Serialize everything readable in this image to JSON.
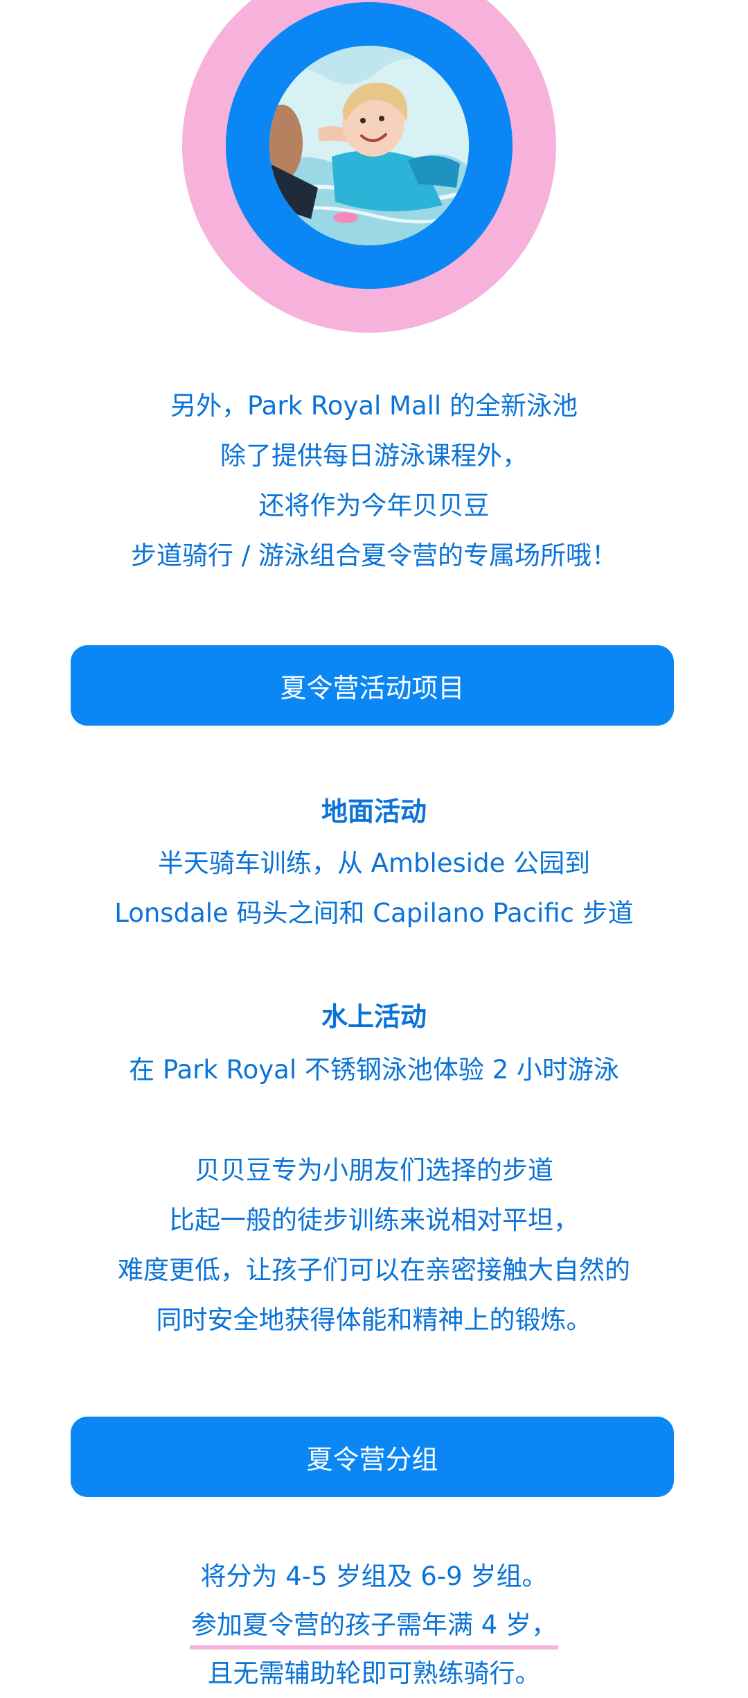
{
  "intro_lines": [
    "另外，Park Royal Mall 的全新泳池",
    "除了提供每日游泳课程外，",
    "还将作为今年贝贝豆",
    "步道骑行 / 游泳组合夏令营的专属场所哦！"
  ],
  "activities_button": "夏令营活动项目",
  "ground": {
    "title": "地面活动",
    "lines": [
      "半天骑车训练，从 Ambleside 公园到",
      "Lonsdale 码头之间和 Capilano Pacific 步道"
    ]
  },
  "water": {
    "title": "水上活动",
    "lines": [
      "在 Park Royal 不锈钢泳池体验 2 小时游泳"
    ]
  },
  "description_lines": [
    "贝贝豆专为小朋友们选择的步道",
    "比起一般的徒步训练来说相对平坦，",
    "难度更低，让孩子们可以在亲密接触大自然的",
    "同时安全地获得体能和精神上的锻炼。"
  ],
  "groups_button": "夏令营分组",
  "groups_lines": {
    "line1": "将分为 4-5 岁组及 6-9 岁组。",
    "line2_underlined": "参加夏令营的孩子需年满 4 岁，",
    "line3": "且无需辅助轮即可熟练骑行。"
  },
  "colors": {
    "accent_blue": "#0a86f5",
    "text_blue": "#0a73d8",
    "pink": "#f7b2dc",
    "background": "#ffffff"
  }
}
